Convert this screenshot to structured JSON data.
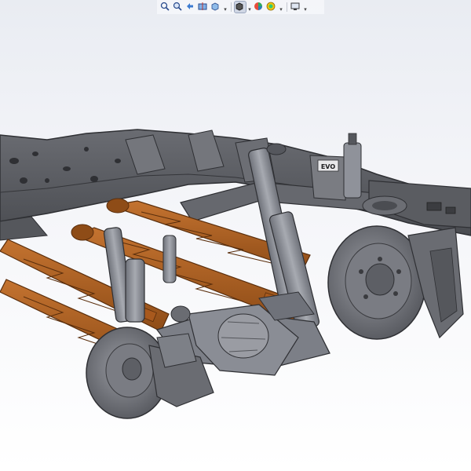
{
  "viewport": {
    "background_top": "#e9ecf2",
    "background_bottom": "#ffffff"
  },
  "model": {
    "frame_color": "#5b5d62",
    "frame_edge": "#2f3034",
    "link_color": "#b0621f",
    "link_edge": "#5a2e0c",
    "shock_color": "#8f929a",
    "axle_color": "#7c7f87",
    "brand_mark": "EVO"
  },
  "heads_up_toolbar": {
    "buttons": [
      {
        "name": "zoom-to-fit",
        "icon": "zoom-to-fit-icon"
      },
      {
        "name": "zoom-to-area",
        "icon": "zoom-to-area-icon"
      },
      {
        "name": "previous-view",
        "icon": "previous-view-icon"
      },
      {
        "name": "section-view",
        "icon": "section-view-icon"
      },
      {
        "name": "view-orientation",
        "icon": "view-orientation-icon"
      },
      {
        "name": "display-style",
        "icon": "display-style-icon"
      },
      {
        "name": "hide-show-items",
        "icon": "hide-show-icon"
      },
      {
        "name": "edit-appearance",
        "icon": "edit-appearance-icon"
      },
      {
        "name": "apply-scene",
        "icon": "apply-scene-icon"
      },
      {
        "name": "view-settings",
        "icon": "view-settings-icon"
      }
    ]
  }
}
